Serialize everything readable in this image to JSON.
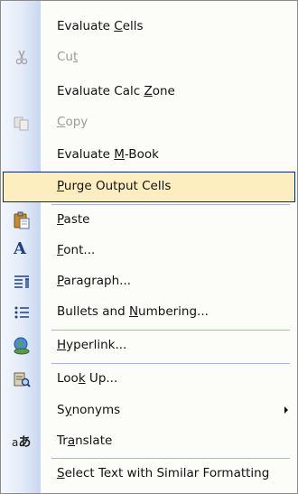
{
  "menu": {
    "items": [
      {
        "pre": "Evaluate ",
        "key": "C",
        "post": "ells"
      },
      {
        "pre": "Cu",
        "key": "t",
        "post": ""
      },
      {
        "pre": "Evaluate Calc ",
        "key": "Z",
        "post": "one"
      },
      {
        "pre": "",
        "key": "C",
        "post": "opy"
      },
      {
        "pre": "Evaluate ",
        "key": "M",
        "post": "-Book"
      },
      {
        "pre": "",
        "key": "P",
        "post": "urge Output Cells"
      },
      {
        "pre": "",
        "key": "P",
        "post": "aste"
      },
      {
        "pre": "",
        "key": "F",
        "post": "ont..."
      },
      {
        "pre": "",
        "key": "P",
        "post": "aragraph..."
      },
      {
        "pre": "Bullets and ",
        "key": "N",
        "post": "umbering..."
      },
      {
        "pre": "",
        "key": "H",
        "post": "yperlink..."
      },
      {
        "pre": "Loo",
        "key": "k",
        "post": " Up..."
      },
      {
        "pre": "S",
        "key": "y",
        "post": "nonyms"
      },
      {
        "pre": "Tr",
        "key": "a",
        "post": "nslate"
      },
      {
        "pre": "",
        "key": "S",
        "post": "elect Text with Similar Formatting"
      }
    ],
    "icons": {
      "font": "A",
      "translate_a": "a",
      "translate_b": "あ"
    },
    "colors": {
      "highlight_bg": "#fdeec0",
      "highlight_border": "#0a2a70",
      "separator": "#a6b6d6",
      "disabled_text": "#9a9a9a"
    }
  }
}
